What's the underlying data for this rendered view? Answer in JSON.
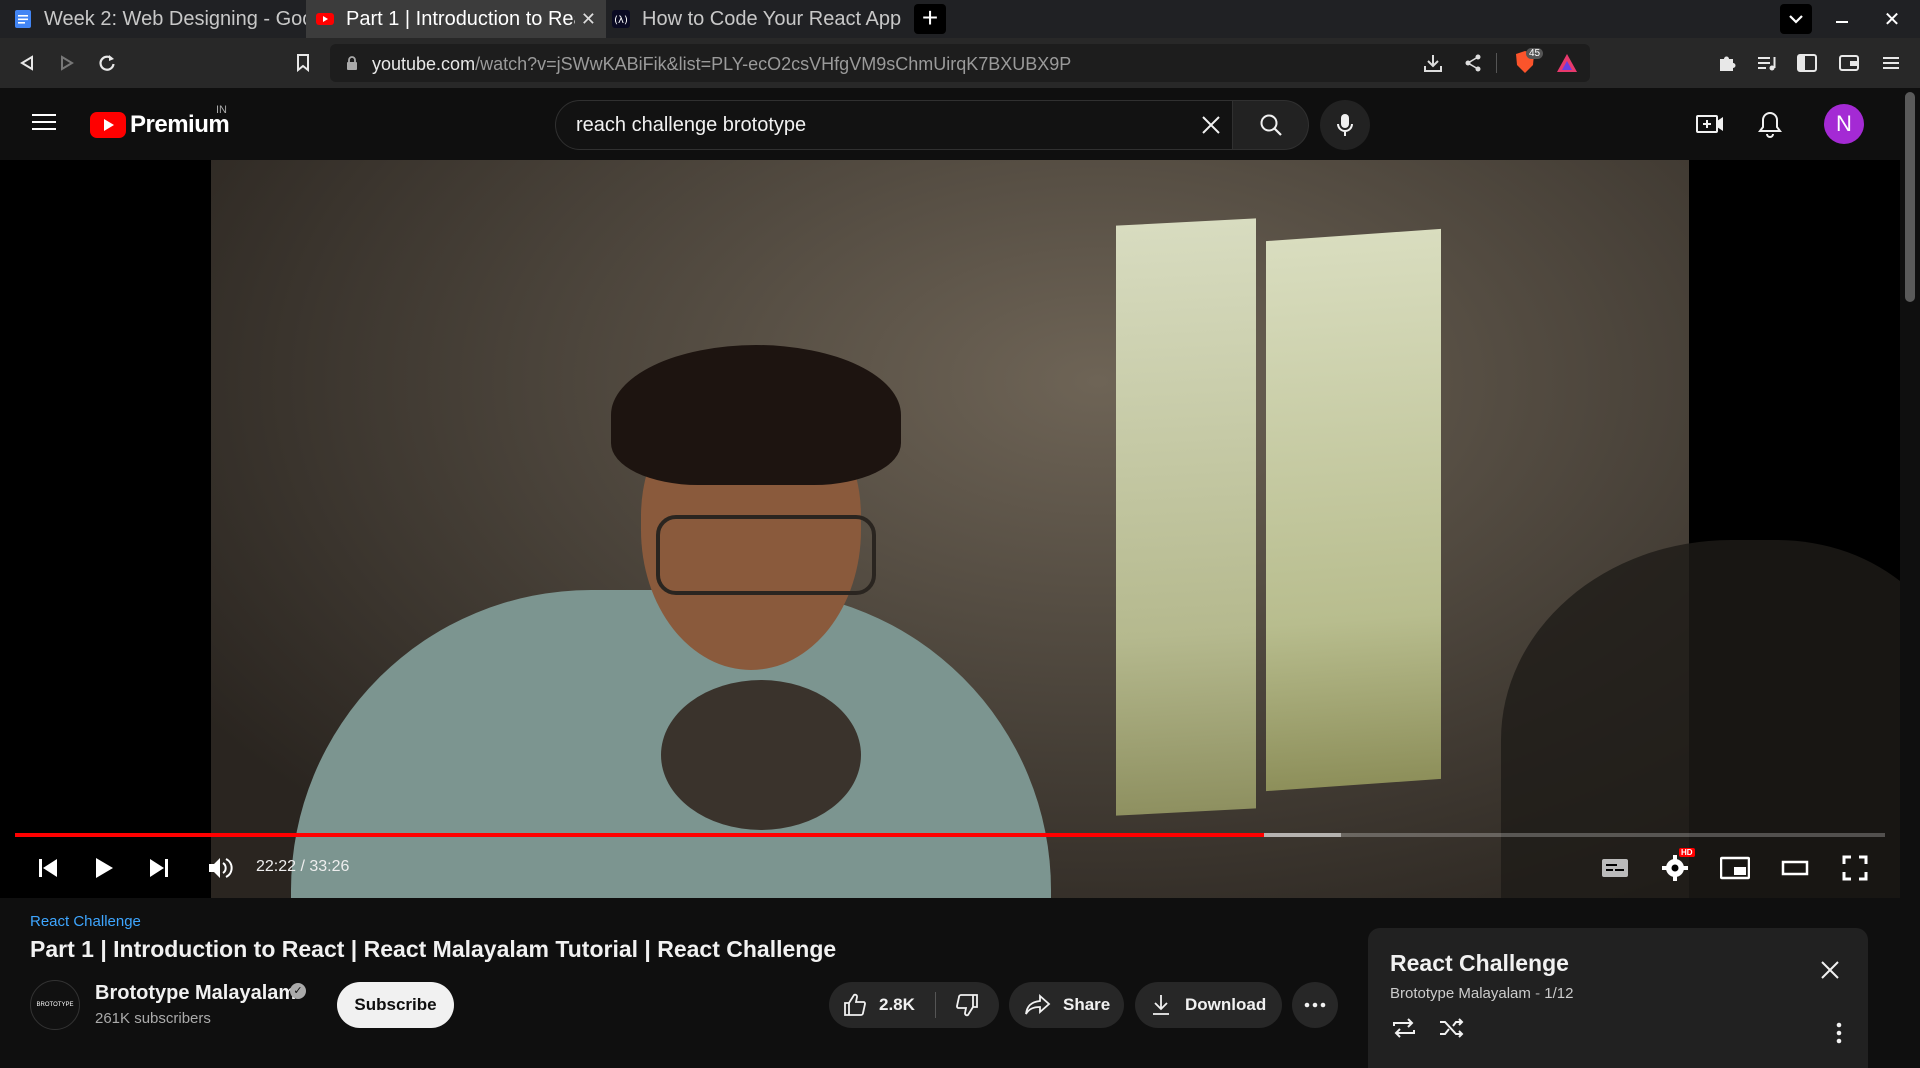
{
  "browser": {
    "tabs": [
      {
        "title": "Week 2: Web Designing - Goo",
        "active": false,
        "icon": "google-docs-icon"
      },
      {
        "title": "Part 1 | Introduction to Rea",
        "active": true,
        "icon": "youtube-icon"
      },
      {
        "title": "How to Code Your React App",
        "active": false,
        "icon": "freecodecamp-icon"
      }
    ],
    "new_tab_label": "+",
    "url_host": "youtube.com",
    "url_path": "/watch?v=jSWwKABiFik&list=PLY-ecO2csVHfgVM9sChmUirqK7BXUBX9P",
    "brave_shield_count": "45"
  },
  "youtube": {
    "logo_text": "Premium",
    "region": "IN",
    "search_value": "reach challenge brototype",
    "avatar_letter": "N",
    "accent_color": "#ff0000"
  },
  "player": {
    "time_display": "22:22 / 33:26",
    "played_fraction": 0.668,
    "buffered_fraction": 0.709,
    "hd_badge": "HD"
  },
  "video": {
    "playlist_name": "React Challenge",
    "title": "Part 1 | Introduction to React | React Malayalam Tutorial | React Challenge",
    "channel_name": "Brototype Malayalam",
    "channel_avatar_text": "BROTOTYPE",
    "subscribers": "261K subscribers",
    "subscribe_label": "Subscribe",
    "like_count": "2.8K",
    "share_label": "Share",
    "download_label": "Download"
  },
  "playlist_panel": {
    "title": "React Challenge",
    "channel": "Brototype Malayalam",
    "position": "1/12"
  }
}
